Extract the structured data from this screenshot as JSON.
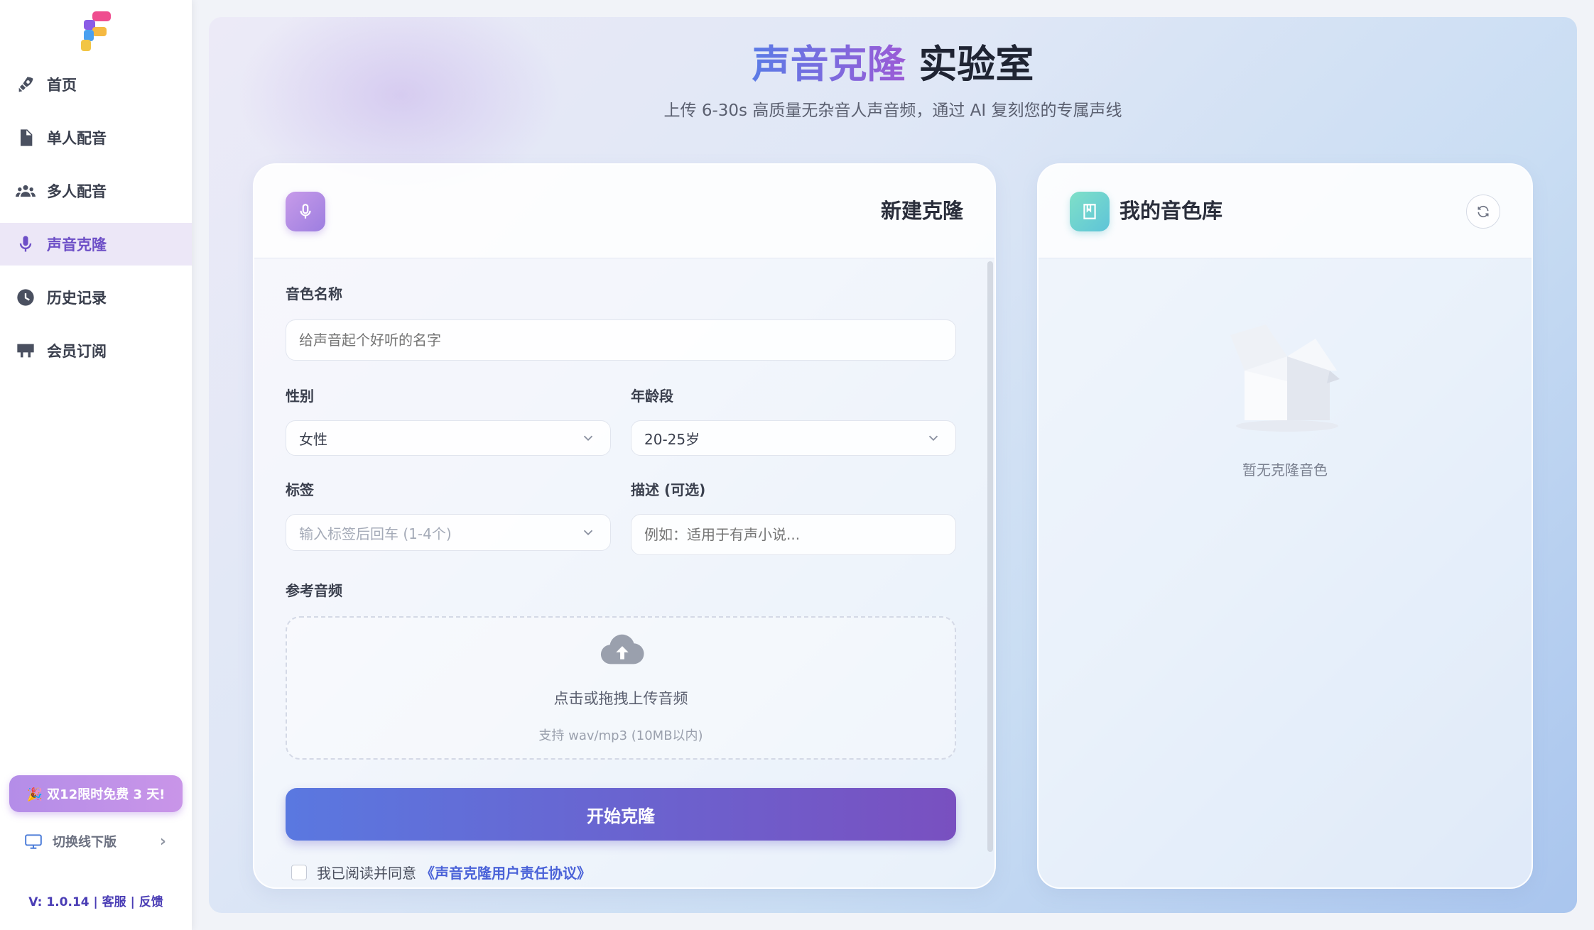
{
  "sidebar": {
    "items": [
      {
        "label": "首页",
        "icon": "rocket-icon",
        "active": false
      },
      {
        "label": "单人配音",
        "icon": "document-icon",
        "active": false
      },
      {
        "label": "多人配音",
        "icon": "group-icon",
        "active": false
      },
      {
        "label": "声音克隆",
        "icon": "microphone-icon",
        "active": true
      },
      {
        "label": "历史记录",
        "icon": "clock-icon",
        "active": false
      },
      {
        "label": "会员订阅",
        "icon": "card-icon",
        "active": false
      }
    ],
    "promo": "🎉 双12限时免费 3 天!",
    "switch_label": "切换线下版",
    "version": "V: 1.0.14 | 客服 | 反馈"
  },
  "header": {
    "title_accent": "声音克隆",
    "title_rest": " 实验室",
    "subtitle": "上传 6-30s 高质量无杂音人声音频，通过 AI 复刻您的专属声线"
  },
  "clone_form": {
    "title": "新建克隆",
    "name_label": "音色名称",
    "name_placeholder": "给声音起个好听的名字",
    "gender_label": "性别",
    "gender_value": "女性",
    "age_label": "年龄段",
    "age_value": "20-25岁",
    "tags_label": "标签",
    "tags_placeholder": "输入标签后回车 (1-4个)",
    "desc_label": "描述 (可选)",
    "desc_placeholder": "例如：适用于有声小说...",
    "audio_label": "参考音频",
    "upload_text": "点击或拖拽上传音频",
    "upload_hint": "支持 wav/mp3 (10MB以内)",
    "start_button": "开始克隆",
    "agree_text": "我已阅读并同意",
    "agree_link": "《声音克隆用户责任协议》"
  },
  "library": {
    "title": "我的音色库",
    "empty_text": "暂无克隆音色"
  },
  "colors": {
    "accent": "#6d4fc7",
    "button_start": "#5a78e0",
    "button_end": "#7950c0"
  }
}
